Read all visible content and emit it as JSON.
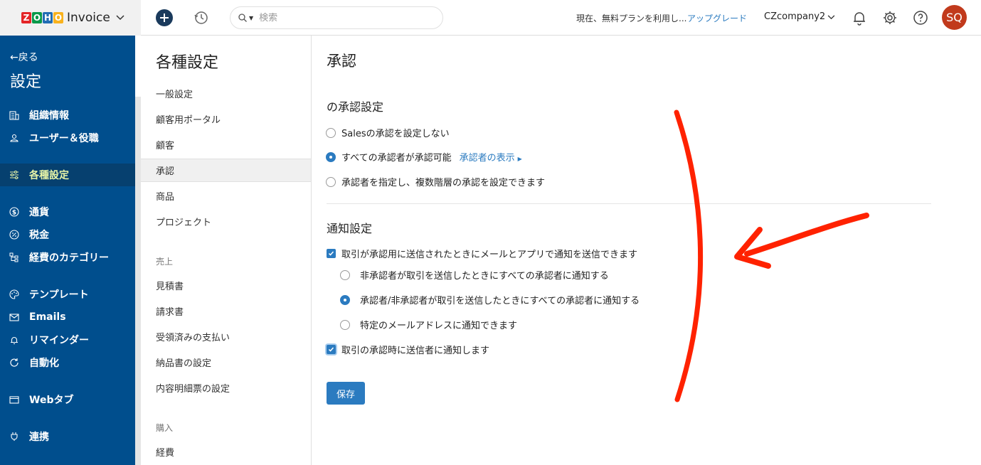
{
  "app": {
    "brand_name": "Invoice",
    "logo_letters": [
      "Z",
      "O",
      "H",
      "O"
    ],
    "logo_colors": [
      "#e42527",
      "#089949",
      "#226db4",
      "#f9b21d"
    ]
  },
  "topbar": {
    "search_placeholder": "検索",
    "plan_text": "現在、無料プランを利用し...",
    "upgrade_label": "アップグレード",
    "org_name": "CZcompany2",
    "avatar_initials": "SQ"
  },
  "sidebar": {
    "back_label": "←戻る",
    "title": "設定",
    "items": [
      {
        "label": "組織情報",
        "icon": "building-icon"
      },
      {
        "label": "ユーザー＆役職",
        "icon": "users-icon"
      },
      {
        "label": "各種設定",
        "icon": "sliders-icon",
        "active": true
      },
      {
        "label": "通貨",
        "icon": "currency-icon"
      },
      {
        "label": "税金",
        "icon": "percent-icon"
      },
      {
        "label": "経費のカテゴリー",
        "icon": "category-icon"
      },
      {
        "label": "テンプレート",
        "icon": "palette-icon"
      },
      {
        "label": "Emails",
        "icon": "mail-icon"
      },
      {
        "label": "リマインダー",
        "icon": "bell-icon"
      },
      {
        "label": "自動化",
        "icon": "refresh-icon"
      },
      {
        "label": "Webタブ",
        "icon": "window-icon"
      },
      {
        "label": "連携",
        "icon": "plug-icon"
      }
    ]
  },
  "settings_menu": {
    "title": "各種設定",
    "items": [
      "一般設定",
      "顧客用ポータル",
      "顧客",
      "承認",
      "商品",
      "プロジェクト"
    ],
    "active_item": "承認",
    "sales_section": "売上",
    "sales_items": [
      "見積書",
      "請求書",
      "受領済みの支払い",
      "納品書の設定",
      "内容明細票の設定"
    ],
    "purchase_section": "購入",
    "purchase_items": [
      "経費"
    ]
  },
  "main": {
    "page_title": "承認",
    "approval_heading": "の承認設定",
    "approval_options": [
      {
        "label": "Salesの承認を設定しない",
        "selected": false
      },
      {
        "label": "すべての承認者が承認可能",
        "selected": true
      },
      {
        "label": "承認者を指定し、複数階層の承認を設定できます",
        "selected": false
      }
    ],
    "show_approvers_link": "承認者の表示",
    "notification_heading": "通知設定",
    "notify_main": {
      "label": "取引が承認用に送信されたときにメールとアプリで通知を送信できます",
      "checked": true
    },
    "notify_options": [
      {
        "label": "非承認者が取引を送信したときにすべての承認者に通知する",
        "selected": false
      },
      {
        "label": "承認者/非承認者が取引を送信したときにすべての承認者に通知する",
        "selected": true
      },
      {
        "label": "特定のメールアドレスに通知できます",
        "selected": false
      }
    ],
    "notify_submitter": {
      "label": "取引の承認時に送信者に通知します",
      "checked": true
    },
    "save_label": "保存"
  },
  "colors": {
    "sidebar_bg": "#004e8d",
    "accent": "#2b7bc0",
    "active_nav_text": "#e8f5a8",
    "annotation_red": "#ff2200"
  }
}
